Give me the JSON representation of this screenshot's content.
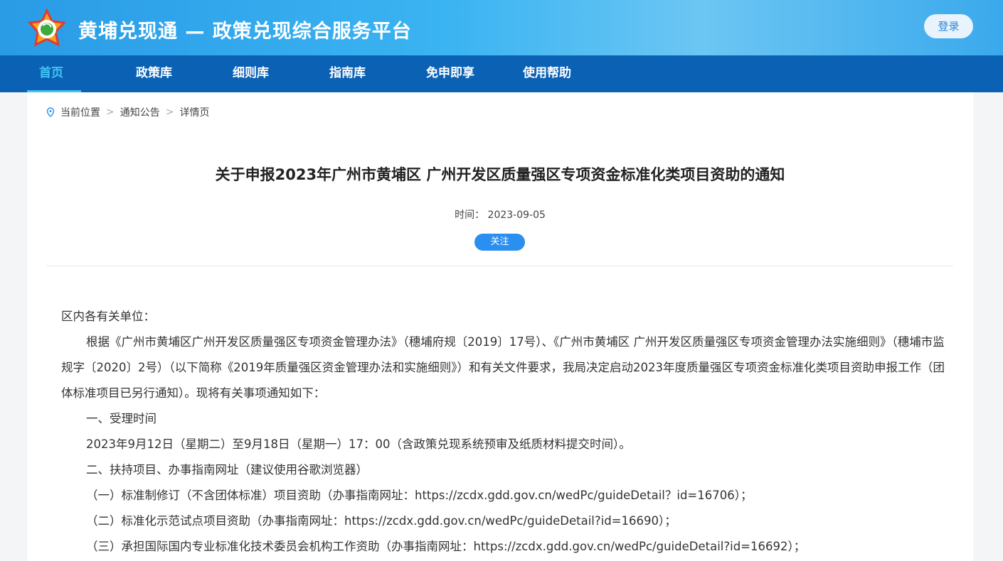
{
  "header": {
    "site_title": "黄埔兑现通 — 政策兑现综合服务平台",
    "login_label": "登录"
  },
  "nav": [
    {
      "label": "首页",
      "active": true
    },
    {
      "label": "政策库"
    },
    {
      "label": "细则库"
    },
    {
      "label": "指南库"
    },
    {
      "label": "免申即享"
    },
    {
      "label": "使用帮助"
    }
  ],
  "breadcrumb": {
    "items": [
      "当前位置",
      "通知公告",
      "详情页"
    ],
    "separator": ">"
  },
  "article": {
    "title": "关于申报2023年广州市黄埔区 广州开发区质量强区专项资金标准化类项目资助的通知",
    "time_label": "时间：",
    "time": "2023-09-05",
    "follow_label": "关注",
    "paragraphs": [
      "区内各有关单位：",
      "根据《广州市黄埔区广州开发区质量强区专项资金管理办法》（穗埔府规〔2019〕17号）、《广州市黄埔区 广州开发区质量强区专项资金管理办法实施细则》（穗埔市监规字〔2020〕2号）（以下简称《2019年质量强区资金管理办法和实施细则》）和有关文件要求，我局决定启动2023年度质量强区专项资金标准化类项目资助申报工作（团体标准项目已另行通知）。现将有关事项通知如下：",
      "一、受理时间",
      "2023年9月12日（星期二）至9月18日（星期一）17：00（含政策兑现系统预审及纸质材料提交时间）。",
      "二、扶持项目、办事指南网址（建议使用谷歌浏览器）",
      "（一）标准制修订（不含团体标准）项目资助（办事指南网址：https://zcdx.gdd.gov.cn/wedPc/guideDetail？id=16706）；",
      "（二）标准化示范试点项目资助（办事指南网址：https://zcdx.gdd.gov.cn/wedPc/guideDetail?id=16690）；",
      "（三）承担国际国内专业标准化技术委员会机构工作资助（办事指南网址：https://zcdx.gdd.gov.cn/wedPc/guideDetail?id=16692）；"
    ]
  },
  "colors": {
    "nav_bg": "#0b62b5",
    "accent": "#41c4f5",
    "button": "#2b8ff0"
  }
}
